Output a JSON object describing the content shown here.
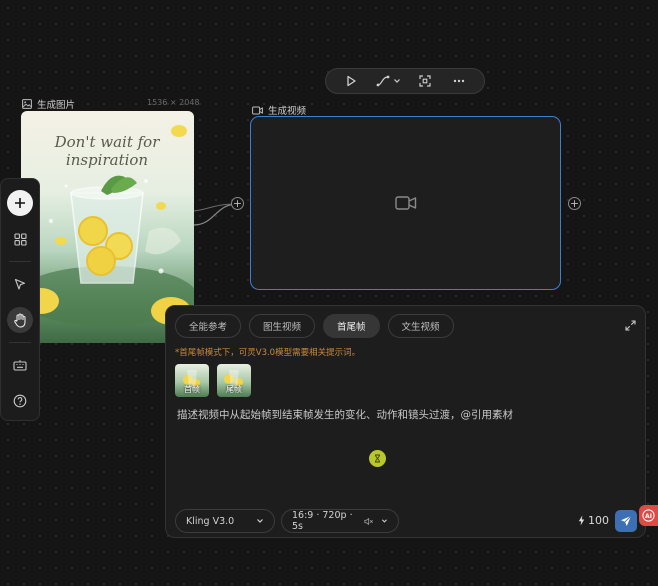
{
  "image_node": {
    "label": "生成图片",
    "dimensions": "1536 × 2048",
    "image_text_line1": "Don't wait for",
    "image_text_line2": "inspiration"
  },
  "video_node": {
    "label": "生成视频"
  },
  "toolbar": {
    "icons": [
      "play-icon",
      "curve-icon",
      "chevron-down-icon",
      "focus-icon",
      "more-icon"
    ]
  },
  "left_toolbar": {
    "icons": [
      "plus-icon",
      "grid-icon",
      "cursor-icon",
      "hand-icon",
      "keyboard-icon",
      "help-icon"
    ]
  },
  "panel": {
    "tabs": [
      {
        "label": "全能参考",
        "active": false
      },
      {
        "label": "图生视频",
        "active": false
      },
      {
        "label": "首尾帧",
        "active": true
      },
      {
        "label": "文生视频",
        "active": false
      }
    ],
    "notice": "*首尾帧模式下，可灵V3.0模型需要相关提示词。",
    "thumbs": [
      {
        "label": "首帧"
      },
      {
        "label": "尾帧"
      }
    ],
    "prompt_placeholder": "描述视频中从起始帧到结束帧发生的变化、动作和镜头过渡，@引用素材",
    "model": "Kling V3.0",
    "settings": "16:9 · 720p · 5s",
    "credits": "100"
  },
  "ai_badge": "AI",
  "colors": {
    "accent_blue": "#3e7fd6",
    "notice_orange": "#c98a3c",
    "send_blue": "#3d6fb5",
    "badge_red": "#e04a44"
  }
}
